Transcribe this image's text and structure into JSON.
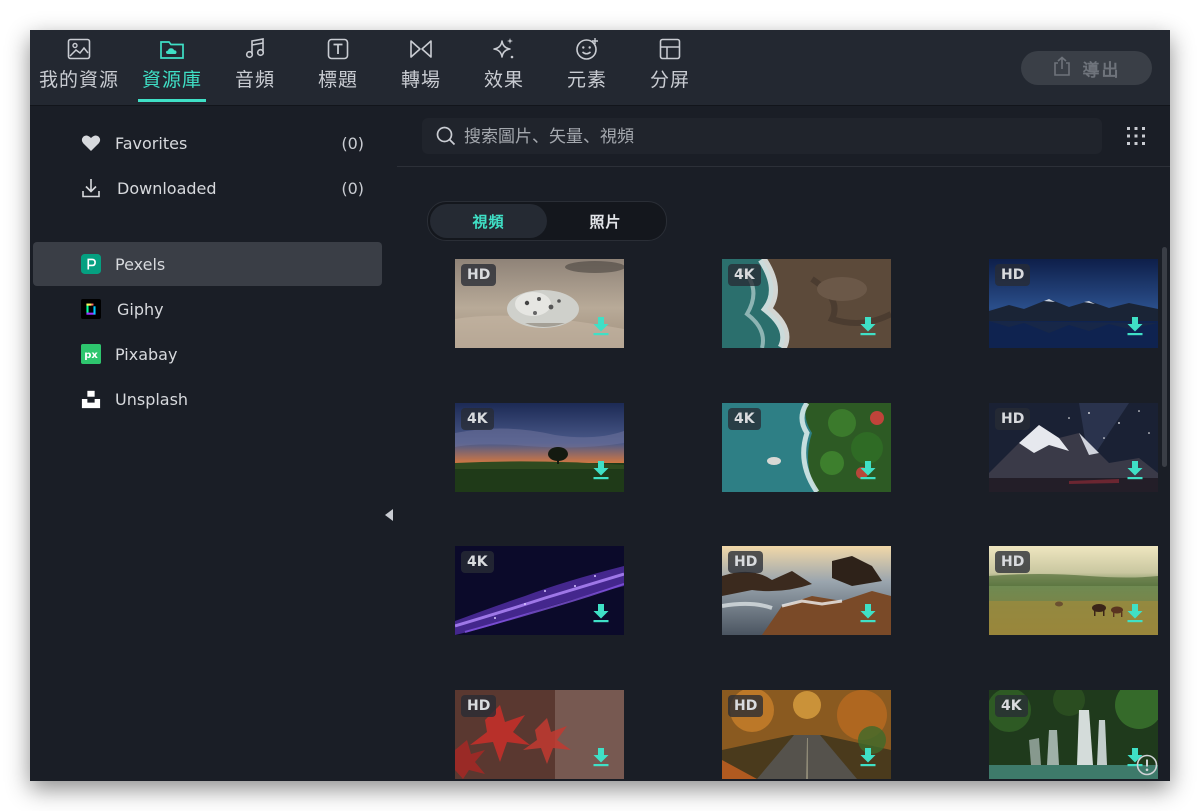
{
  "toolbar": {
    "tabs": [
      {
        "label": "我的資源",
        "icon": "image-icon"
      },
      {
        "label": "資源庫",
        "icon": "folder-cloud-icon",
        "active": true
      },
      {
        "label": "音頻",
        "icon": "music-note-icon"
      },
      {
        "label": "標題",
        "icon": "text-t-icon"
      },
      {
        "label": "轉場",
        "icon": "transition-icon"
      },
      {
        "label": "效果",
        "icon": "sparkle-icon"
      },
      {
        "label": "元素",
        "icon": "smiley-icon"
      },
      {
        "label": "分屏",
        "icon": "split-screen-icon"
      }
    ],
    "export_label": "導出"
  },
  "sidebar": {
    "items": [
      {
        "label": "Favorites",
        "count": "(0)",
        "icon": "heart-icon"
      },
      {
        "label": "Downloaded",
        "count": "(0)",
        "icon": "download-icon"
      },
      {
        "label": "Pexels",
        "count": "",
        "icon": "pexels-logo-icon",
        "active": true
      },
      {
        "label": "Giphy",
        "count": "",
        "icon": "giphy-logo-icon"
      },
      {
        "label": "Pixabay",
        "count": "",
        "icon": "pixabay-logo-icon"
      },
      {
        "label": "Unsplash",
        "count": "",
        "icon": "unsplash-logo-icon"
      }
    ]
  },
  "search": {
    "placeholder": "搜索圖片、矢量、視頻"
  },
  "media_tabs": {
    "video": "視頻",
    "photo": "照片"
  },
  "thumbnails": [
    {
      "badge": "HD",
      "scene": "seal-on-beach"
    },
    {
      "badge": "4K",
      "scene": "aerial-coast"
    },
    {
      "badge": "HD",
      "scene": "mountain-lake-night"
    },
    {
      "badge": "4K",
      "scene": "sunset-tree"
    },
    {
      "badge": "4K",
      "scene": "aerial-forest-coast"
    },
    {
      "badge": "HD",
      "scene": "snowy-mountain-stars"
    },
    {
      "badge": "4K",
      "scene": "purple-particles"
    },
    {
      "badge": "HD",
      "scene": "rocky-waterfront"
    },
    {
      "badge": "HD",
      "scene": "horses-field"
    },
    {
      "badge": "HD",
      "scene": "red-maple-leaves"
    },
    {
      "badge": "HD",
      "scene": "autumn-road"
    },
    {
      "badge": "4K",
      "scene": "forest-waterfall"
    }
  ],
  "colors": {
    "accent": "#3fe0c6",
    "background": "#1a1e26",
    "toolbar": "#232831"
  }
}
